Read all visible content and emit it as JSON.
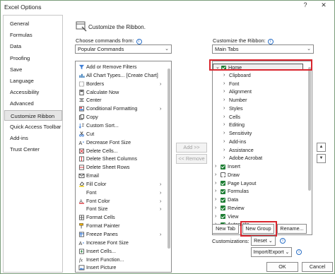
{
  "window": {
    "title": "Excel Options",
    "help_label": "?",
    "close_label": "✕"
  },
  "nav": {
    "items": [
      "General",
      "Formulas",
      "Data",
      "Proofing",
      "Save",
      "Language",
      "Accessibility",
      "Advanced",
      "Customize Ribbon",
      "Quick Access Toolbar",
      "Add-ins",
      "Trust Center"
    ],
    "selected": "Customize Ribbon"
  },
  "main": {
    "header": "Customize the Ribbon.",
    "choose_label": "Choose commands from:",
    "choose_value": "Popular Commands",
    "customize_label": "Customize the Ribbon:",
    "customize_value": "Main Tabs",
    "commands": [
      {
        "label": "Add or Remove Filters",
        "icon": "filter-icon"
      },
      {
        "label": "All Chart Types... [Create Chart]",
        "icon": "chart-icon"
      },
      {
        "label": "Borders",
        "icon": "borders-icon",
        "submenu": true
      },
      {
        "label": "Calculate Now",
        "icon": "calculator-icon"
      },
      {
        "label": "Center",
        "icon": "center-align-icon"
      },
      {
        "label": "Conditional Formatting",
        "icon": "conditional-formatting-icon",
        "submenu": true
      },
      {
        "label": "Copy",
        "icon": "copy-icon"
      },
      {
        "label": "Custom Sort...",
        "icon": "sort-icon"
      },
      {
        "label": "Cut",
        "icon": "cut-icon"
      },
      {
        "label": "Decrease Font Size",
        "icon": "decrease-font-icon"
      },
      {
        "label": "Delete Cells...",
        "icon": "delete-cells-icon"
      },
      {
        "label": "Delete Sheet Columns",
        "icon": "delete-columns-icon"
      },
      {
        "label": "Delete Sheet Rows",
        "icon": "delete-rows-icon"
      },
      {
        "label": "Email",
        "icon": "email-icon"
      },
      {
        "label": "Fill Color",
        "icon": "fill-color-icon",
        "submenu": true
      },
      {
        "label": "Font",
        "icon": "",
        "submenu": true
      },
      {
        "label": "Font Color",
        "icon": "font-color-icon",
        "submenu": true
      },
      {
        "label": "Font Size",
        "icon": "",
        "submenu": true
      },
      {
        "label": "Format Cells",
        "icon": "format-cells-icon"
      },
      {
        "label": "Format Painter",
        "icon": "format-painter-icon"
      },
      {
        "label": "Freeze Panes",
        "icon": "freeze-panes-icon",
        "submenu": true
      },
      {
        "label": "Increase Font Size",
        "icon": "increase-font-icon"
      },
      {
        "label": "Insert Cells...",
        "icon": "insert-cells-icon"
      },
      {
        "label": "Insert Function...",
        "icon": "function-icon"
      },
      {
        "label": "Insert Picture",
        "icon": "picture-icon"
      }
    ],
    "add_button": "Add >>",
    "remove_button": "<< Remove",
    "tree": [
      {
        "label": "Home",
        "level": 0,
        "expanded": true,
        "checked": true,
        "highlight": true
      },
      {
        "label": "Clipboard",
        "level": 1
      },
      {
        "label": "Font",
        "level": 1
      },
      {
        "label": "Alignment",
        "level": 1
      },
      {
        "label": "Number",
        "level": 1
      },
      {
        "label": "Styles",
        "level": 1
      },
      {
        "label": "Cells",
        "level": 1
      },
      {
        "label": "Editing",
        "level": 1
      },
      {
        "label": "Sensitivity",
        "level": 1
      },
      {
        "label": "Add-ins",
        "level": 1
      },
      {
        "label": "Assistance",
        "level": 1
      },
      {
        "label": "Adobe Acrobat",
        "level": 1
      },
      {
        "label": "Insert",
        "level": 0,
        "checked": true
      },
      {
        "label": "Draw",
        "level": 0,
        "checked": false
      },
      {
        "label": "Page Layout",
        "level": 0,
        "checked": true
      },
      {
        "label": "Formulas",
        "level": 0,
        "checked": true
      },
      {
        "label": "Data",
        "level": 0,
        "checked": true
      },
      {
        "label": "Review",
        "level": 0,
        "checked": true
      },
      {
        "label": "View",
        "level": 0,
        "checked": true
      },
      {
        "label": "Automate",
        "level": 0,
        "checked": true
      }
    ],
    "new_tab": "New Tab",
    "new_group": "New Group",
    "rename": "Rename...",
    "customizations_label": "Customizations:",
    "reset": "Reset",
    "import_export": "Import/Export",
    "ok": "OK",
    "cancel": "Cancel"
  },
  "colors": {
    "highlight_red": "#d9262e",
    "check_green": "#1e7e34",
    "info_blue": "#2a6fc6"
  }
}
